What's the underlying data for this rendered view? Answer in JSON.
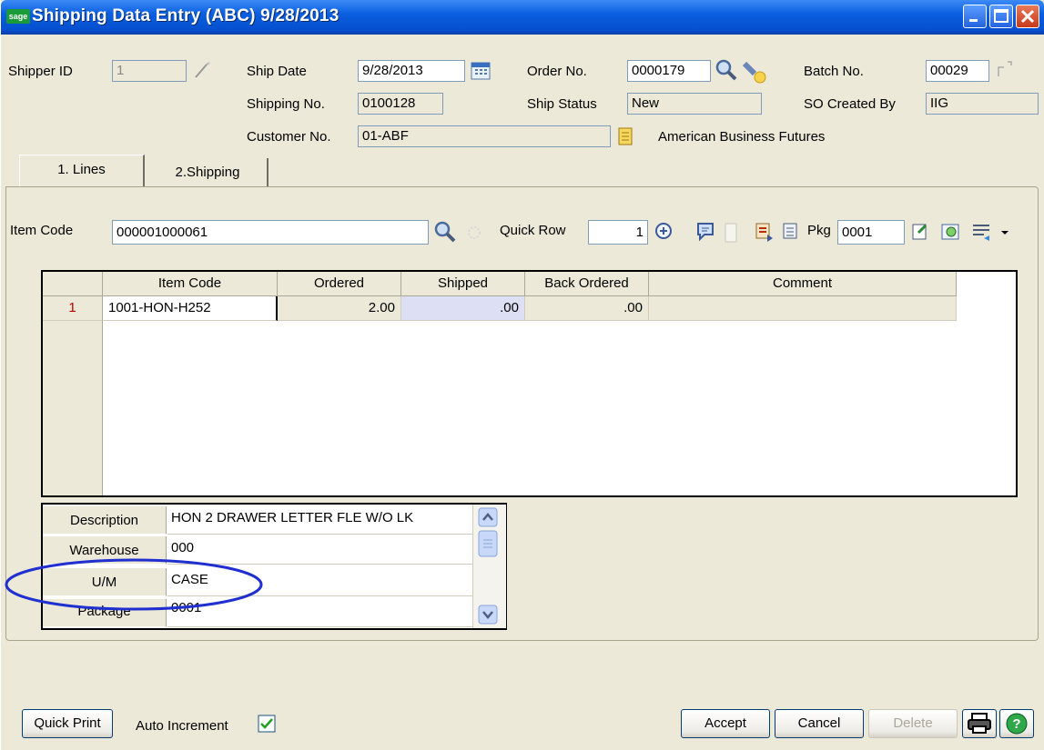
{
  "window": {
    "logo": "sage",
    "title": "Shipping Data Entry (ABC) 9/28/2013",
    "buttons": [
      "minimize-icon",
      "maximize-icon",
      "close-icon"
    ]
  },
  "header": {
    "shipper_id_label": "Shipper ID",
    "shipper_id_value": "1",
    "ship_date_label": "Ship Date",
    "ship_date_value": "9/28/2013",
    "order_no_label": "Order No.",
    "order_no_value": "0000179",
    "batch_no_label": "Batch No.",
    "batch_no_value": "00029",
    "shipping_no_label": "Shipping No.",
    "shipping_no_value": "0100128",
    "ship_status_label": "Ship Status",
    "ship_status_value": "New",
    "so_created_by_label": "SO Created By",
    "so_created_by_value": "IIG",
    "customer_no_label": "Customer No.",
    "customer_no_value": "01-ABF",
    "customer_name": "American Business Futures"
  },
  "tabs": [
    {
      "label": "1. Lines",
      "active": true
    },
    {
      "label": "2.Shipping",
      "active": false
    }
  ],
  "lines_toolbar": {
    "item_code_label": "Item Code",
    "item_code_value": "000001000061",
    "quick_row_label": "Quick Row",
    "quick_row_value": "1",
    "pkg_label": "Pkg",
    "pkg_value": "0001"
  },
  "grid": {
    "columns": [
      "Item Code",
      "Ordered",
      "Shipped",
      "Back Ordered",
      "Comment"
    ],
    "rows": [
      {
        "row_no": "1",
        "item_code": "1001-HON-H252",
        "ordered": "2.00",
        "shipped": ".00",
        "back_ordered": ".00",
        "comment": ""
      }
    ]
  },
  "details": {
    "description_label": "Description",
    "description_value": "HON 2 DRAWER LETTER FLE W/O LK",
    "warehouse_label": "Warehouse",
    "warehouse_value": "000",
    "um_label": "U/M",
    "um_value": "CASE",
    "package_label": "Package",
    "package_value": "0001"
  },
  "footer": {
    "quick_print_label": "Quick Print",
    "auto_increment_label": "Auto Increment",
    "auto_increment_checked": true,
    "accept_label": "Accept",
    "cancel_label": "Cancel",
    "delete_label": "Delete"
  },
  "colors": {
    "titlebar": "#0a5fe0",
    "window_bg": "#ece9d8",
    "highlight_ellipse": "#1f2fd0",
    "shipped_cell": "#dde0f5",
    "row_number": "#c00000"
  }
}
